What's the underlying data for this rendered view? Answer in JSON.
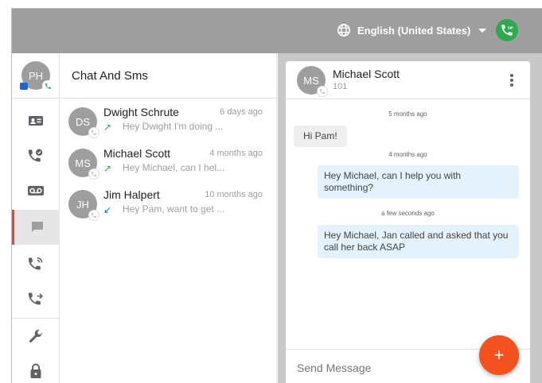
{
  "header": {
    "language": "English (United States)",
    "icons": {
      "language": "globe-icon",
      "sip_status": "sip-phone-icon"
    },
    "sip_color": "#2fa84f"
  },
  "user": {
    "initials": "PH"
  },
  "rail": {
    "items": [
      {
        "name": "contacts-icon"
      },
      {
        "name": "call-history-icon"
      },
      {
        "name": "voicemail-icon"
      },
      {
        "name": "chat-icon",
        "active": true
      },
      {
        "name": "call-forward-icon"
      },
      {
        "name": "call-transfer-icon"
      },
      {
        "name": "wrench-icon"
      },
      {
        "name": "lock-icon"
      }
    ],
    "active_color": "#f44336"
  },
  "conversations": {
    "title": "Chat And Sms",
    "items": [
      {
        "initials": "DS",
        "name": "Dwight Schrute",
        "time": "6 days ago",
        "direction": "outgoing",
        "arrow": "↗",
        "preview": "Hey Dwight I'm doing ..."
      },
      {
        "initials": "MS",
        "name": "Michael Scott",
        "time": "4 months ago",
        "direction": "outgoing",
        "arrow": "↗",
        "preview": "Hey Michael, can I hel..."
      },
      {
        "initials": "JH",
        "name": "Jim Halpert",
        "time": "10 months ago",
        "direction": "incoming",
        "arrow": "↙",
        "preview": "Hey Pam, want to get ..."
      }
    ]
  },
  "chat": {
    "initials": "MS",
    "name": "Michael Scott",
    "extension": "101",
    "messages": [
      {
        "stamp": "5 months ago",
        "text": "Hi Pam!",
        "direction": "in"
      },
      {
        "stamp": "4 months ago",
        "text": "Hey Michael, can I help you with something?",
        "direction": "out"
      },
      {
        "stamp": "a few seconds ago",
        "text": "Hey Michael, Jan called and asked that you call her back ASAP",
        "direction": "out"
      }
    ],
    "compose_placeholder": "Send Message",
    "fab_label": "+",
    "fab_color": "#f4511e"
  }
}
